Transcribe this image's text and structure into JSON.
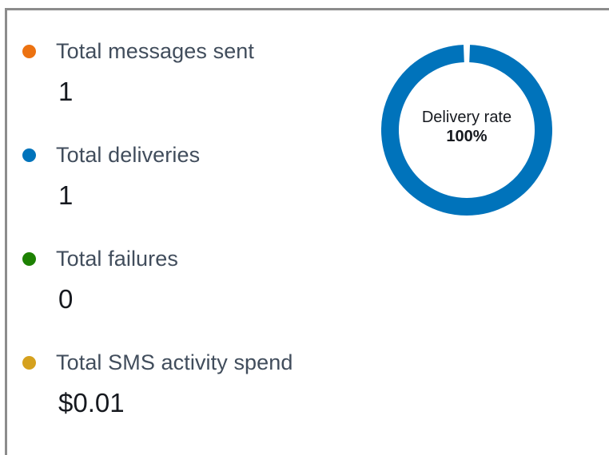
{
  "metrics": [
    {
      "label": "Total messages sent",
      "value": "1",
      "color": "#ec7211"
    },
    {
      "label": "Total deliveries",
      "value": "1",
      "color": "#0073bb"
    },
    {
      "label": "Total failures",
      "value": "0",
      "color": "#1d8102"
    },
    {
      "label": "Total SMS activity spend",
      "value": "$0.01",
      "color": "#d5a11e"
    }
  ],
  "delivery_rate": {
    "label": "Delivery rate",
    "value_text": "100%",
    "fraction": 1.0,
    "ring_color": "#0073bb"
  }
}
